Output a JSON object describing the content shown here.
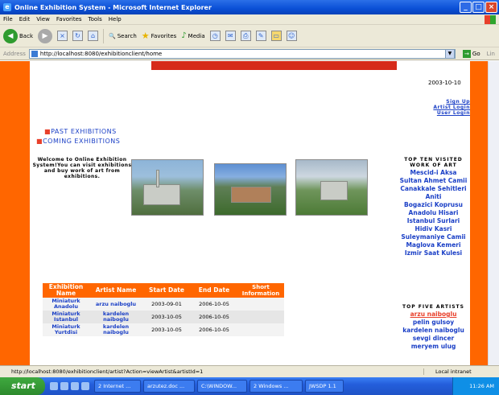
{
  "window": {
    "title": "Online Exhibition System - Microsoft Internet Explorer"
  },
  "menubar": {
    "items": [
      "File",
      "Edit",
      "View",
      "Favorites",
      "Tools",
      "Help"
    ]
  },
  "toolbar": {
    "back": "Back",
    "search": "Search",
    "favorites": "Favorites",
    "media": "Media"
  },
  "address": {
    "label": "Address",
    "url": "http://localhost:8080/exhibitionclient/home",
    "go": "Go",
    "links": "Lin"
  },
  "page": {
    "date": "2003-10-10",
    "top_links": [
      "Sign Up",
      "Artist Login",
      "User Login"
    ],
    "nav": [
      "PAST EXHIBITIONS",
      "COMING EXHIBITIONS"
    ],
    "welcome": "Welcome to Online Exhibition System!You can visit exhibitions and buy work of art from exhibitions.",
    "top_ten": {
      "heading": "TOP TEN VISITED WORK OF ART",
      "items": [
        "Mescid-i Aksa",
        "Sultan Ahmet Camii",
        "Canakkale Sehitleri Aniti",
        "Bogazici Koprusu",
        "Anadolu Hisari",
        "Istanbul Surlari",
        "Hidiv Kasri",
        "Suleymaniye Camii",
        "Maglova Kemeri",
        "Izmir Saat Kulesi"
      ]
    },
    "top_five": {
      "heading": "TOP FIVE ARTISTS",
      "items": [
        "arzu naiboglu",
        "pelin gulsoy",
        "kardelen naiboglu",
        "sevgi dincer",
        "meryem ulug"
      ]
    },
    "table": {
      "headers": [
        "Exhibition Name",
        "Artist Name",
        "Start Date",
        "End Date",
        "Short Information"
      ],
      "rows": [
        [
          "Miniaturk Anadolu",
          "arzu naiboglu",
          "2003-09-01",
          "2006-10-05",
          ""
        ],
        [
          "Miniaturk Istanbul",
          "kardelen naiboglu",
          "2003-10-05",
          "2006-10-05",
          ""
        ],
        [
          "Miniaturk Yurtdisi",
          "kardelen naiboglu",
          "2003-10-05",
          "2006-10-05",
          ""
        ]
      ]
    }
  },
  "status": {
    "url": "http://localhost:8080/exhibitionclient/artist?Action=viewArtist&artistId=1",
    "zone": "Local intranet"
  },
  "taskbar": {
    "start": "start",
    "tasks": [
      "2 Internet ...",
      "arzutez.doc ...",
      "C:\\WINDOW...",
      "2 Windows ...",
      "JWSDP 1.1"
    ],
    "clock": "11:26 AM"
  }
}
